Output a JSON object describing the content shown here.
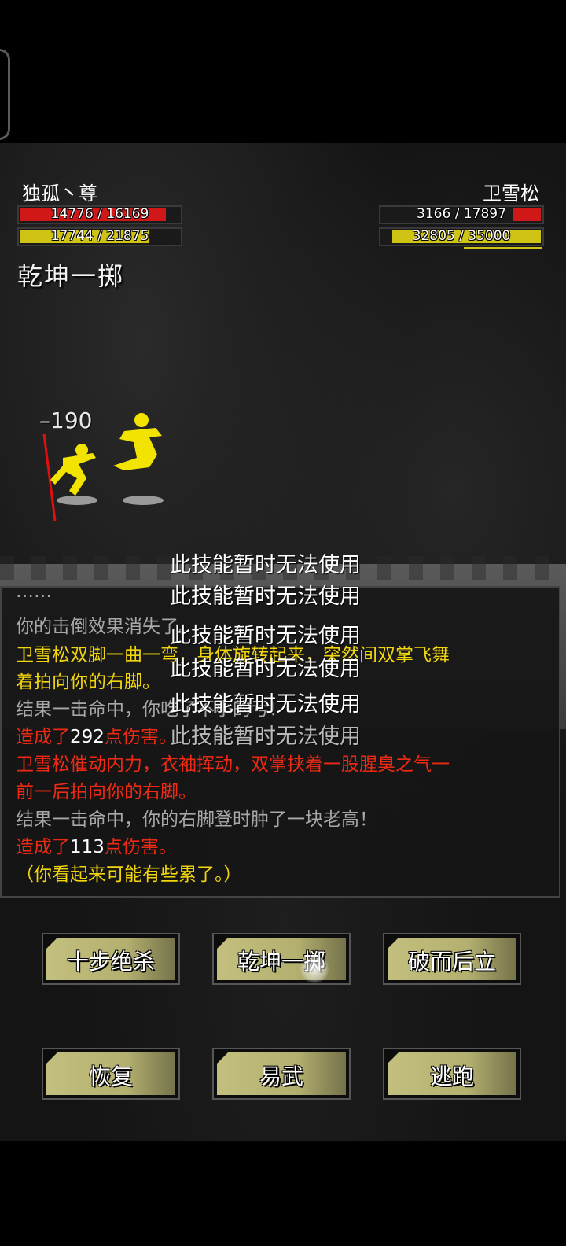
{
  "player": {
    "name": "独孤丶尊",
    "hp_text": "14776 / 16169",
    "hp_current": 14776,
    "hp_max": 16169,
    "mp_text": "17744 / 21875",
    "mp_current": 17744,
    "mp_max": 21875
  },
  "enemy": {
    "name": "卫雪松",
    "hp_text": "3166 / 17897",
    "hp_current": 3166,
    "hp_max": 17897,
    "mp_text": "32805 / 35000",
    "mp_current": 32805,
    "mp_max": 35000
  },
  "current_skill": "乾坤一掷",
  "damage_popup": "–190",
  "colors": {
    "hp": "#d01818",
    "mp": "#cfc414",
    "log_yellow": "#f2d60c",
    "log_red": "#ee2a14",
    "log_gray": "#a8a8a8",
    "button": "#b9b575"
  },
  "log": [
    {
      "text": "你的击倒效果消失了。",
      "style": "gray"
    },
    {
      "text": "卫雪松双脚一曲一弯，身体旋转起来，突然间双掌飞舞",
      "style": "yellow"
    },
    {
      "text": "着拍向你的右脚。",
      "style": "yellow"
    },
    {
      "text": "结果一击命中，你吃了不小的亏！",
      "style": "gray"
    },
    {
      "pre": "造成了",
      "num": "292",
      "post": "点伤害。",
      "style": "red"
    },
    {
      "text": "卫雪松催动内力，衣袖挥动，双掌挟着一股腥臭之气一",
      "style": "red"
    },
    {
      "text": "前一后拍向你的右脚。",
      "style": "red"
    },
    {
      "text": "结果一击命中，你的右脚登时肿了一块老高！",
      "style": "gray"
    },
    {
      "pre": "造成了",
      "num": "113",
      "post": "点伤害。",
      "style": "red"
    },
    {
      "text": "（你看起来可能有些累了。）",
      "style": "yellow"
    }
  ],
  "toast_text": "此技能暂时无法使用",
  "toasts": [
    "此技能暂时无法使用",
    "此技能暂时无法使用",
    "此技能暂时无法使用",
    "此技能暂时无法使用",
    "此技能暂时无法使用",
    "此技能暂时无法使用"
  ],
  "buttons": {
    "skill_1": "十步绝杀",
    "skill_2": "乾坤一掷",
    "skill_3": "破而后立",
    "recover": "恢复",
    "switch_weapon": "易武",
    "flee": "逃跑"
  }
}
